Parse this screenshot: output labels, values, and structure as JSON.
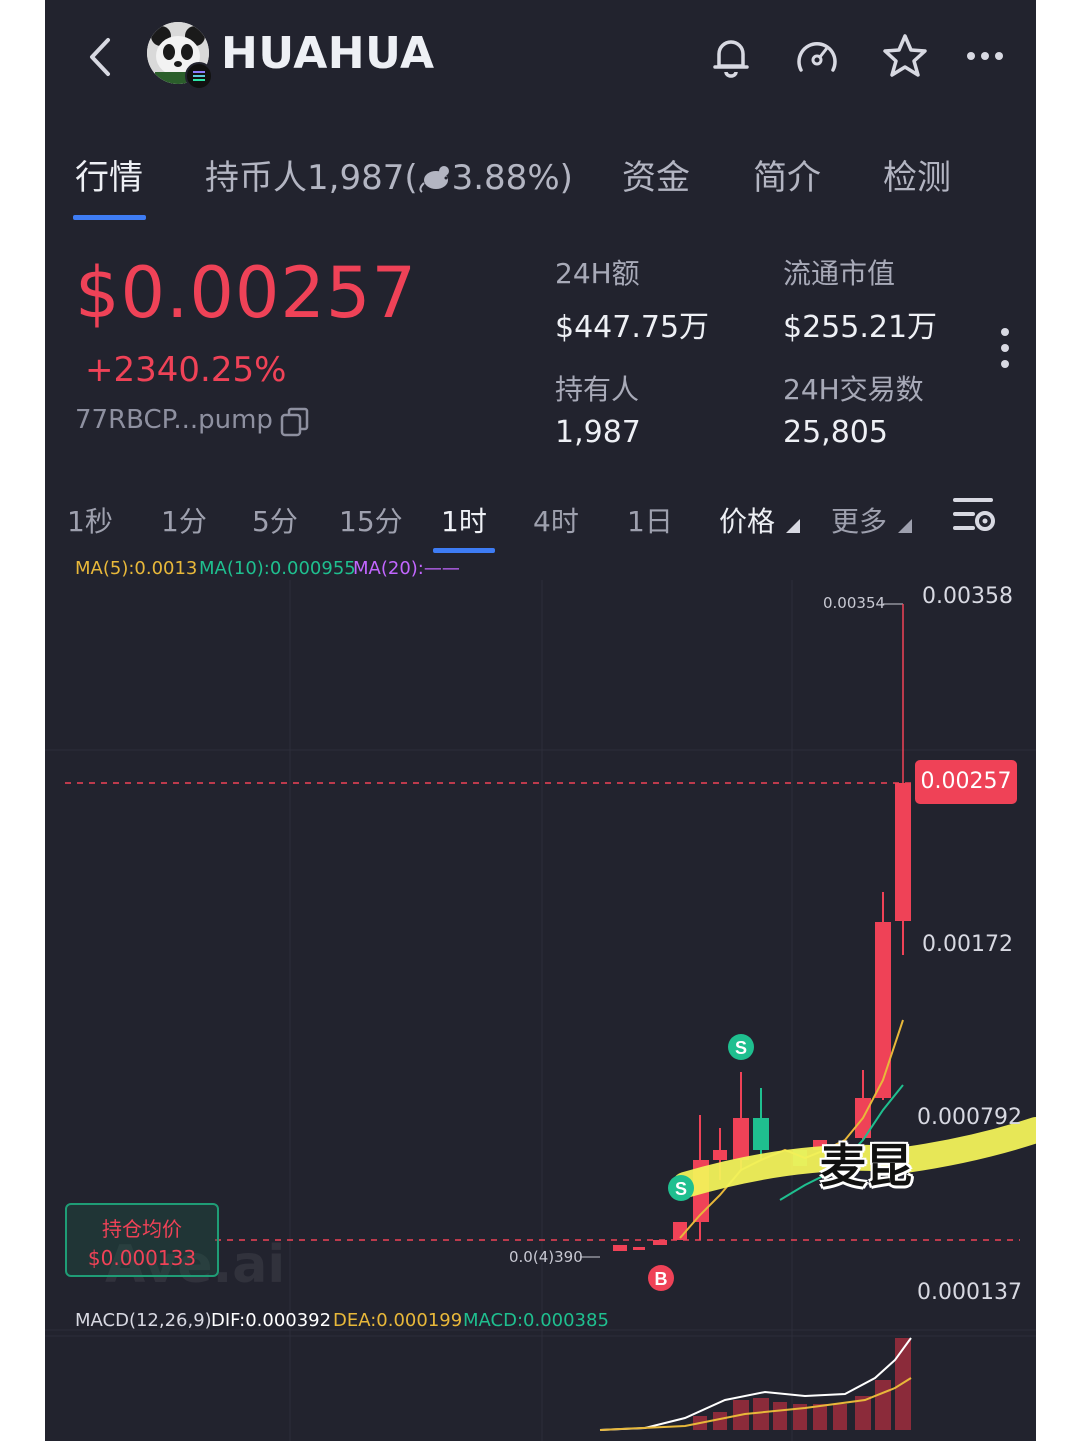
{
  "header": {
    "title": "HUAHUA",
    "icons": [
      "back-arrow-icon",
      "bell-icon",
      "gauge-icon",
      "star-icon",
      "more-icon"
    ]
  },
  "tabs": [
    {
      "label": "行情",
      "active": true
    },
    {
      "label": "持币人1,987(",
      "active": false
    },
    {
      "label": "资金",
      "active": false
    },
    {
      "label": "简介",
      "active": false
    },
    {
      "label": "检测",
      "active": false
    }
  ],
  "holders_tab_pct": "3.88%)",
  "price": {
    "value": "$0.00257",
    "change": "+2340.25%",
    "address": "77RBCP...pump"
  },
  "stats": {
    "vol_label": "24H额",
    "vol_value": "$447.75万",
    "mcap_label": "流通市值",
    "mcap_value": "$255.21万",
    "holders_label": "持有人",
    "holders_value": "1,987",
    "txns_label": "24H交易数",
    "txns_value": "25,805"
  },
  "intervals": [
    "1秒",
    "1分",
    "5分",
    "15分",
    "1时",
    "4时",
    "1日",
    "价格",
    "更多"
  ],
  "active_interval": "1时",
  "indicators": {
    "ma5": "MA(5):0.0013",
    "ma10": "MA(10):0.000955",
    "ma20": "MA(20):——"
  },
  "chart_axis": {
    "high_label": "0.00354",
    "y1": "0.00358",
    "current": "0.00257",
    "y2": "0.00172",
    "y3": "0.000792",
    "low_label": "0.0(4)390",
    "y4": "0.000137"
  },
  "hold_cost": {
    "label": "持仓均价",
    "value": "$0.000133"
  },
  "watermark": "Ave.ai",
  "markers": {
    "sell": "S",
    "buy": "B"
  },
  "macd": {
    "name": "MACD(12,26,9)",
    "dif": "DIF:0.000392",
    "dea": "DEA:0.000199",
    "macd": "MACD:0.000385"
  },
  "overlay_text": "麦昆",
  "colors": {
    "background": "#22232e",
    "up": "#ef4257",
    "down": "#1fbf8f",
    "accent": "#3e7cf4",
    "ma5": "#e8b83a",
    "ma10": "#1fbf8f",
    "ma20": "#c266ff"
  }
}
